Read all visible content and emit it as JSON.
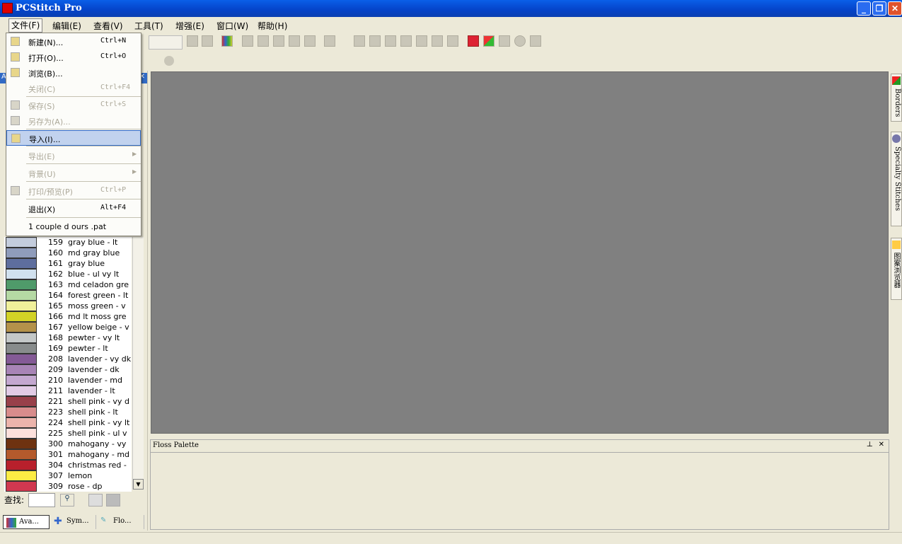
{
  "window": {
    "title": "PCStitch Pro"
  },
  "menubar": [
    "文件(F)",
    "编辑(E)",
    "查看(V)",
    "工具(T)",
    "增强(E)",
    "窗口(W)",
    "帮助(H)"
  ],
  "file_menu": [
    {
      "label": "新建(N)...",
      "shortcut": "Ctrl+N",
      "icon": "new-file-icon",
      "enabled": true
    },
    {
      "label": "打开(O)...",
      "shortcut": "Ctrl+O",
      "icon": "folder-open-icon",
      "enabled": true
    },
    {
      "label": "浏览(B)...",
      "shortcut": "",
      "icon": "browse-icon",
      "enabled": true
    },
    {
      "label": "关闭(C)",
      "shortcut": "Ctrl+F4",
      "enabled": false
    },
    {
      "label": "保存(S)",
      "shortcut": "Ctrl+S",
      "icon": "save-icon",
      "enabled": false
    },
    {
      "label": "另存为(A)...",
      "shortcut": "",
      "icon": "save-as-icon",
      "enabled": false
    },
    {
      "label": "导入(I)...",
      "shortcut": "",
      "icon": "import-icon",
      "enabled": true,
      "highlighted": true
    },
    {
      "label": "导出(E)",
      "shortcut": "",
      "submenu": true,
      "enabled": false
    },
    {
      "label": "背景(U)",
      "shortcut": "",
      "submenu": true,
      "enabled": false
    },
    {
      "label": "打印/预览(P)",
      "shortcut": "Ctrl+P",
      "icon": "print-icon",
      "enabled": false
    },
    {
      "label": "退出(X)",
      "shortcut": "Alt+F4",
      "enabled": true
    },
    {
      "label": "1  couple d ours .pat",
      "shortcut": "",
      "enabled": true
    }
  ],
  "left_panel": {
    "title": "Ava...",
    "floss_list": [
      {
        "num": "159",
        "name": "gray blue - lt",
        "color": "#c4cddd"
      },
      {
        "num": "160",
        "name": "md gray blue",
        "color": "#8f9cbb"
      },
      {
        "num": "161",
        "name": "gray blue",
        "color": "#5e6e9e"
      },
      {
        "num": "162",
        "name": "blue - ul vy lt",
        "color": "#d1e1ef"
      },
      {
        "num": "163",
        "name": "md celadon gre",
        "color": "#4f9a6a"
      },
      {
        "num": "164",
        "name": "forest green - lt",
        "color": "#b5d9a4"
      },
      {
        "num": "165",
        "name": "moss green - v",
        "color": "#f0f09a"
      },
      {
        "num": "166",
        "name": "md lt moss gre",
        "color": "#d2d226"
      },
      {
        "num": "167",
        "name": "yellow beige - v",
        "color": "#b4924a"
      },
      {
        "num": "168",
        "name": "pewter - vy lt",
        "color": "#c4c8c8"
      },
      {
        "num": "169",
        "name": "pewter - lt",
        "color": "#888c8c"
      },
      {
        "num": "208",
        "name": "lavender - vy dk",
        "color": "#845a96"
      },
      {
        "num": "209",
        "name": "lavender - dk",
        "color": "#a884b6"
      },
      {
        "num": "210",
        "name": "lavender - md",
        "color": "#c4a8d0"
      },
      {
        "num": "211",
        "name": "lavender - lt",
        "color": "#e2cce6"
      },
      {
        "num": "221",
        "name": "shell pink - vy d",
        "color": "#98404a"
      },
      {
        "num": "223",
        "name": "shell pink - lt",
        "color": "#d88c8c"
      },
      {
        "num": "224",
        "name": "shell pink - vy lt",
        "color": "#ecb4ac"
      },
      {
        "num": "225",
        "name": "shell pink - ul v",
        "color": "#fce0dc"
      },
      {
        "num": "300",
        "name": "mahogany - vy",
        "color": "#6e3210"
      },
      {
        "num": "301",
        "name": "mahogany - md",
        "color": "#b45a2c"
      },
      {
        "num": "304",
        "name": "christmas red -",
        "color": "#b8202c"
      },
      {
        "num": "307",
        "name": "lemon",
        "color": "#fcec44"
      },
      {
        "num": "309",
        "name": "rose - dp",
        "color": "#d03850"
      }
    ],
    "find_label": "查找:",
    "find_value": "",
    "tabs": [
      "Ava...",
      "Sym...",
      "Flo..."
    ]
  },
  "floss_palette": {
    "title": "Floss Palette"
  },
  "right_tabs": [
    "Borders",
    "Specialty Stitches",
    "图案浏览器"
  ]
}
